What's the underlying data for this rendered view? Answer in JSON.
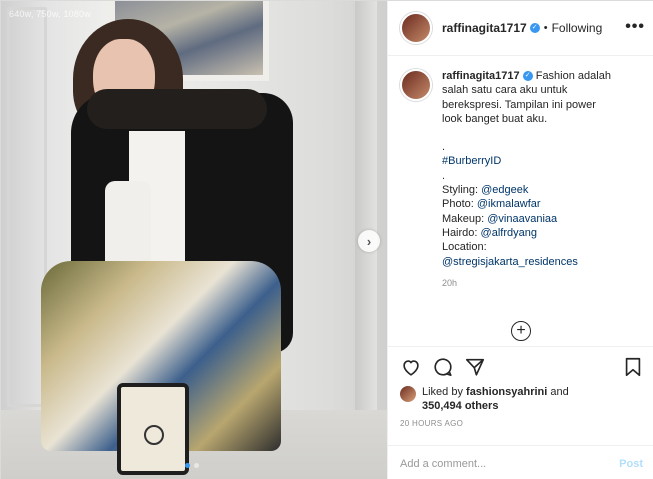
{
  "photo": {
    "watermark": "640w, 750w, 1080w",
    "next_arrow": "›",
    "carousel_dots": 2,
    "active_dot": 0
  },
  "header": {
    "username": "raffinagita1717",
    "verified_mark": "✓",
    "separator": "•",
    "follow_status": "Following",
    "more_menu": "•••"
  },
  "caption": {
    "username": "raffinagita1717",
    "verified_mark": "✓",
    "lines": [
      "Fashion adalah",
      "salah satu cara aku untuk",
      "berekspresi. Tampilan ini power",
      "look banget buat aku."
    ],
    "dot1": ".",
    "hashtag": "#BurberryID",
    "dot2": ".",
    "credits": {
      "styling_label": "Styling: ",
      "styling": "@edgeek",
      "photo_label": "Photo: ",
      "photo": "@ikmalawfar",
      "makeup_label": "Makeup: ",
      "makeup": "@vinaavaniaa",
      "hairdo_label": "Hairdo: ",
      "hairdo": "@alfrdyang",
      "location_label": "Location:",
      "location": "@stregisjakarta_residences"
    },
    "time_ago": "20h"
  },
  "load_more_comments": "+",
  "actions": {
    "icons": [
      "heart-icon",
      "comment-icon",
      "share-icon",
      "bookmark-icon"
    ],
    "liked_by_prefix": "Liked by ",
    "liked_by_user": "fashionsyahrini",
    "liked_by_and": " and",
    "liked_count": "350,494 others",
    "post_date": "20 HOURS AGO"
  },
  "comment": {
    "placeholder": "Add a comment...",
    "post_label": "Post"
  },
  "colors": {
    "link": "#003569",
    "accent": "#3897f0",
    "muted": "#8e8e8e",
    "post_disabled": "#b2dffc"
  }
}
